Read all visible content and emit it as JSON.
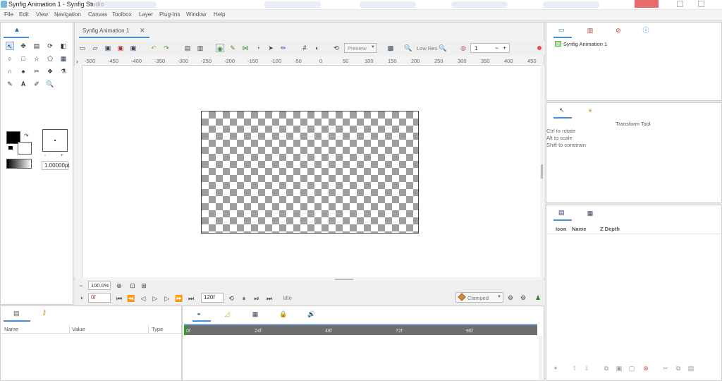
{
  "window": {
    "title": "Synfig Animation 1 - Synfig Studio"
  },
  "menu": [
    "File",
    "Edit",
    "View",
    "Navigation",
    "Canvas",
    "Toolbox",
    "Layer",
    "Plug-Ins",
    "Window",
    "Help"
  ],
  "document_tab": {
    "label": "Synfig Animation 1"
  },
  "toolbar": {
    "preview_label": "Preview",
    "lowres_label": "Low Res",
    "zoom_value": "1",
    "minus": "−",
    "plus": "+"
  },
  "ruler": {
    "h_ticks": [
      "-500",
      "-450",
      "-400",
      "-350",
      "-300",
      "-250",
      "-200",
      "-150",
      "-100",
      "-50",
      "0",
      "50",
      "100",
      "150",
      "200",
      "250",
      "300",
      "350",
      "400",
      "450"
    ],
    "v_ticks": [
      "",
      "",
      "",
      "",
      "",
      "",
      "",
      "",
      "",
      ""
    ]
  },
  "toolbox": {
    "brush_size": "1.00000pt"
  },
  "canvas_bottom": {
    "zoom": "100.0%",
    "current_frame": "0f",
    "end_frame": "120f",
    "status": "Idle",
    "interpolation": "Clamped"
  },
  "params": {
    "col_name": "Name",
    "col_value": "Value",
    "col_type": "Type"
  },
  "timeline": {
    "marks": [
      "0f",
      "24f",
      "48f",
      "72f",
      "96f"
    ]
  },
  "canvas_browser": {
    "item": "Synfig Animation 1"
  },
  "tool_options": {
    "title": "Transform Tool",
    "lines": [
      "Ctrl to rotate",
      "Alt to scale",
      "Shift to constrain"
    ]
  },
  "layers": {
    "col_icon": "Icon",
    "col_name": "Name",
    "col_zdepth": "Z Depth"
  },
  "colors": {
    "accent": "#4a90d9",
    "checker": "#9f9f9f",
    "timebar": "#6e6e6e"
  }
}
